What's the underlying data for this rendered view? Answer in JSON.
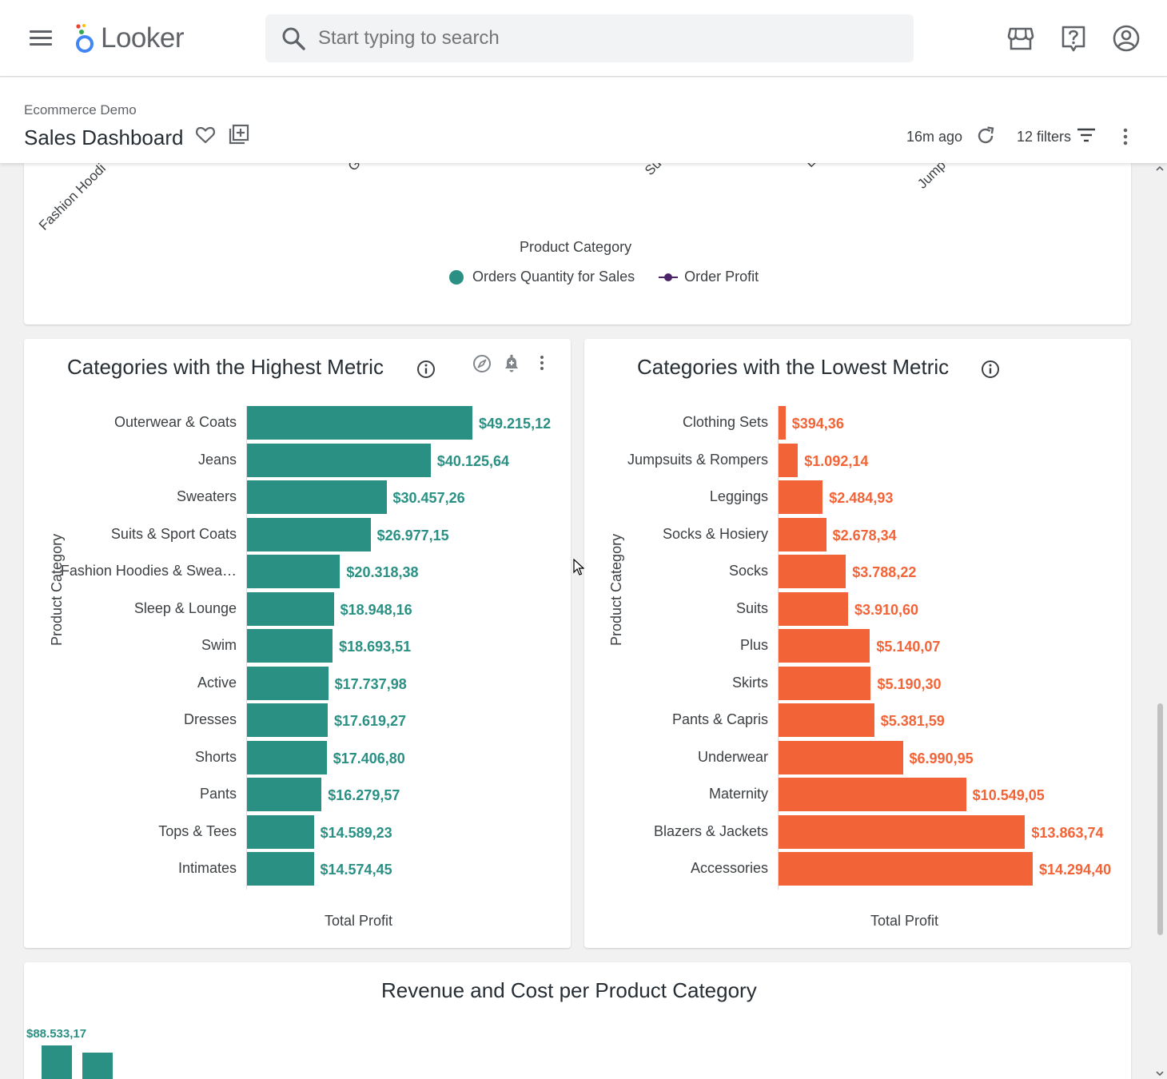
{
  "app": {
    "logo_text": "Looker",
    "search_placeholder": "Start typing to search"
  },
  "dashboard": {
    "breadcrumb": "Ecommerce Demo",
    "title": "Sales Dashboard",
    "updated": "16m ago",
    "filters_label": "12 filters"
  },
  "top_tile": {
    "x_axis_title": "Product Category",
    "partial_x_labels": [
      "Fashion Hoodi",
      "G",
      "Su",
      "L",
      "Jump"
    ],
    "legend": [
      "Orders Quantity for Sales",
      "Order Profit"
    ],
    "colors": {
      "quantity": "#2a9083",
      "profit": "#4a2466"
    }
  },
  "highest_tile": {
    "title": "Categories with the Highest Metric",
    "y_axis_title": "Product Category",
    "x_axis_title": "Total Profit",
    "color": "#2a9083"
  },
  "lowest_tile": {
    "title": "Categories with the Lowest Metric",
    "y_axis_title": "Product Category",
    "x_axis_title": "Total Profit",
    "color": "#f26437"
  },
  "revenue_tile": {
    "title": "Revenue and Cost per Product Category",
    "first_value_label": "$88.533,17"
  },
  "chart_data": [
    {
      "type": "bar",
      "orientation": "horizontal",
      "title": "Categories with the Highest Metric",
      "xlabel": "Total Profit",
      "ylabel": "Product Category",
      "categories": [
        "Outerwear & Coats",
        "Jeans",
        "Sweaters",
        "Suits & Sport Coats",
        "Fashion Hoodies & Swea…",
        "Sleep & Lounge",
        "Swim",
        "Active",
        "Dresses",
        "Shorts",
        "Pants",
        "Tops & Tees",
        "Intimates"
      ],
      "values": [
        49215.12,
        40125.64,
        30457.26,
        26977.15,
        20318.38,
        18948.16,
        18693.51,
        17737.98,
        17619.27,
        17406.8,
        16279.57,
        14589.23,
        14574.45
      ],
      "value_labels": [
        "$49.215,12",
        "$40.125,64",
        "$30.457,26",
        "$26.977,15",
        "$20.318,38",
        "$18.948,16",
        "$18.693,51",
        "$17.737,98",
        "$17.619,27",
        "$17.406,80",
        "$16.279,57",
        "$14.589,23",
        "$14.574,45"
      ],
      "xlim": [
        0,
        49215.12
      ]
    },
    {
      "type": "bar",
      "orientation": "horizontal",
      "title": "Categories with the Lowest Metric",
      "xlabel": "Total Profit",
      "ylabel": "Product Category",
      "categories": [
        "Clothing Sets",
        "Jumpsuits & Rompers",
        "Leggings",
        "Socks & Hosiery",
        "Socks",
        "Suits",
        "Plus",
        "Skirts",
        "Pants & Capris",
        "Underwear",
        "Maternity",
        "Blazers & Jackets",
        "Accessories"
      ],
      "values": [
        394.36,
        1092.14,
        2484.93,
        2678.34,
        3788.22,
        3910.6,
        5140.07,
        5190.3,
        5381.59,
        6990.95,
        10549.05,
        13863.74,
        14294.4
      ],
      "value_labels": [
        "$394,36",
        "$1.092,14",
        "$2.484,93",
        "$2.678,34",
        "$3.788,22",
        "$3.910,60",
        "$5.140,07",
        "$5.190,30",
        "$5.381,59",
        "$6.990,95",
        "$10.549,05",
        "$13.863,74",
        "$14.294,40"
      ],
      "xlim": [
        0,
        14294.4
      ]
    },
    {
      "type": "bar",
      "title": "Revenue and Cost per Product Category",
      "series": [
        {
          "values": [
            88533.17
          ]
        },
        {
          "values": [
            74000
          ]
        }
      ],
      "value_labels": [
        "$88.533,17"
      ],
      "colors": [
        "#2a9083",
        "#2a9083"
      ]
    }
  ]
}
